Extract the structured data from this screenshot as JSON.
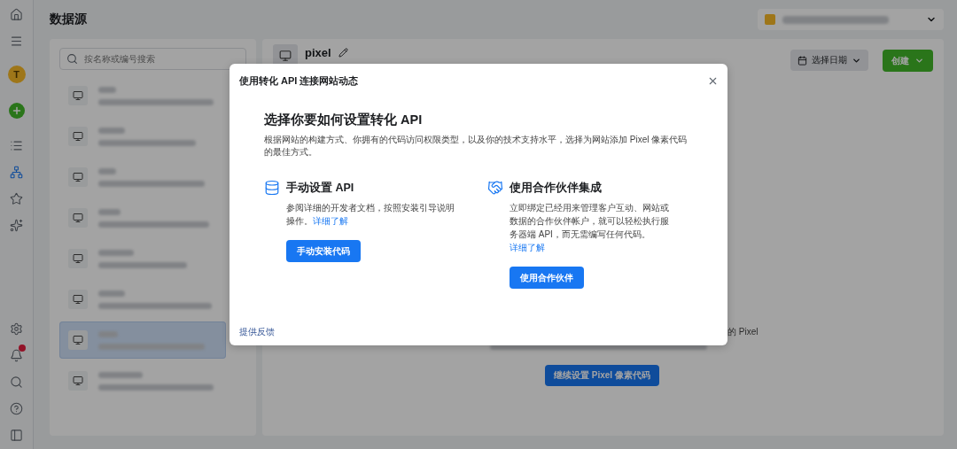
{
  "nav": {
    "top_items": [
      {
        "kind": "home",
        "selected": false
      },
      {
        "kind": "menu",
        "selected": false
      },
      {
        "kind": "avatar",
        "label": "T",
        "selected": false
      },
      {
        "kind": "create",
        "selected": false
      },
      {
        "kind": "list",
        "selected": false
      },
      {
        "kind": "sources",
        "selected": true
      },
      {
        "kind": "star",
        "selected": false
      },
      {
        "kind": "integrations",
        "selected": false
      }
    ],
    "bottom_items": [
      {
        "kind": "settings",
        "selected": false
      },
      {
        "kind": "notifications",
        "selected": false
      },
      {
        "kind": "search",
        "selected": false
      },
      {
        "kind": "help",
        "selected": false
      },
      {
        "kind": "panel",
        "selected": false
      }
    ]
  },
  "header": {
    "title": "数据源"
  },
  "source_list": {
    "search_placeholder": "按名称或编号搜索",
    "items": [
      {
        "selected": false
      },
      {
        "selected": false
      },
      {
        "selected": false
      },
      {
        "selected": false
      },
      {
        "selected": false
      },
      {
        "selected": false
      },
      {
        "selected": true
      },
      {
        "selected": false
      }
    ]
  },
  "detail": {
    "name": "pixel",
    "date_button": "选择日期",
    "create_button": "创建",
    "partial_text": "的 Pixel",
    "continue_button": "继续设置 Pixel 像素代码"
  },
  "dialog": {
    "title": "使用转化 API 连接网站动态",
    "heading": "选择你要如何设置转化 API",
    "description": "根据网站的构建方式、你拥有的代码访问权限类型，以及你的技术支持水平，选择为网站添加 Pixel 像素代码的最佳方式。",
    "options": [
      {
        "kind": "manual",
        "title": "手动设置 API",
        "description": "参阅详细的开发者文档，按照安装引导说明操作。",
        "link": "详细了解",
        "button": "手动安装代码"
      },
      {
        "kind": "partner",
        "title": "使用合作伙伴集成",
        "description": "立即绑定已经用来管理客户互动、网站或数据的合作伙伴帐户，就可以轻松执行服务器端 API，而无需编写任何代码。",
        "link": "详细了解",
        "button": "使用合作伙伴"
      }
    ],
    "feedback_link": "提供反馈"
  }
}
